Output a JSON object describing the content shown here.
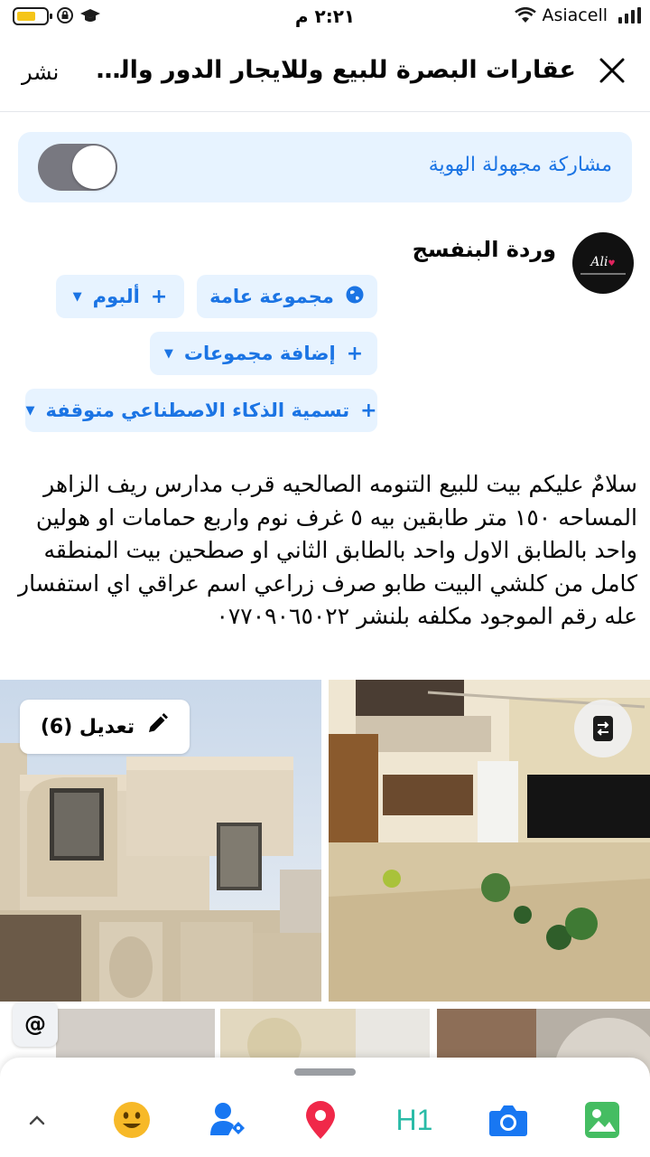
{
  "status_bar": {
    "time": "٢:٢١ م",
    "carrier": "Asiacell"
  },
  "header": {
    "title": "عقارات البصرة للبيع وللايجار الدور والمشتملا...",
    "post_label": "نشر"
  },
  "anonymous": {
    "label": "مشاركة مجهولة الهوية",
    "enabled": false
  },
  "author": {
    "name": "وردة البنفسج",
    "avatar_text": "Ali"
  },
  "audience": {
    "public_group": "مجموعة عامة",
    "album": "ألبوم",
    "add_groups": "إضافة مجموعات",
    "ai_label": "تسمية الذكاء الاصطناعي متوقفة"
  },
  "post": {
    "text": "سلامٌ عليكم بيت للبيع التنومه الصالحيه قرب مدارس ريف الزاهر المساحه ١٥٠ متر طابقين بيه ٥ غرف نوم واربع حمامات او هولين واحد بالطابق الاول واحد بالطابق الثاني او صطحين بيت المنطقه كامل من كلشي البيت طابو صرف زراعي اسم عراقي اي استفسار عله رقم الموجود مكلفه بلنشر ٠٧٧٠٩٠٦٥٠٢٢"
  },
  "photos": {
    "edit_label": "تعديل (6)",
    "count": 6
  },
  "toolbar": {
    "icons": [
      "chevron-up-icon",
      "emoji-icon",
      "tag-people-icon",
      "location-icon",
      "heading-icon",
      "camera-icon",
      "photo-icon"
    ],
    "heading_label": "H1"
  },
  "colors": {
    "accent": "#1b74e4",
    "pill_bg": "#e7f3ff",
    "emoji": "#f7b928",
    "location": "#f02849",
    "heading": "#2abba7",
    "photo": "#45bd62"
  }
}
